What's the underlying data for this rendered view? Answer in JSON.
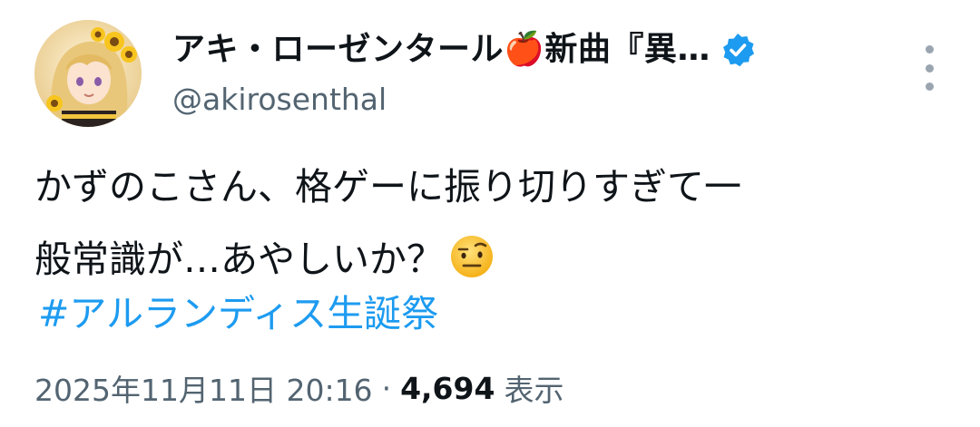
{
  "author": {
    "display_name": "アキ・ローゼンタール🍎新曲『異…",
    "handle": "@akirosenthal",
    "verified": true
  },
  "tweet": {
    "text_line_1": "かずのこさん、格ゲーに振り切りすぎて一",
    "text_line_2": "般常識が…あやしいか？",
    "emoji": "face-with-raised-eyebrow",
    "hashtag": "#アルランディス生誕祭"
  },
  "meta": {
    "timestamp": "2025年11月11日 20:16",
    "separator": "·",
    "view_count": "4,694",
    "views_label": "表示"
  },
  "colors": {
    "text": "#0f1419",
    "secondary": "#536471",
    "link": "#1d9bf0",
    "verified": "#1d9bf0"
  }
}
